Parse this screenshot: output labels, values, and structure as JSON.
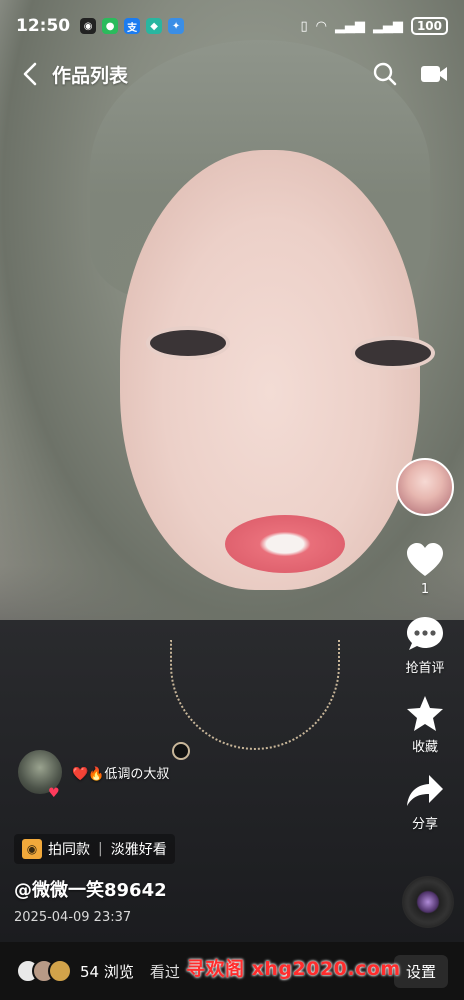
{
  "status": {
    "time": "12:50",
    "battery": "100",
    "notif_icons": [
      "qq-icon",
      "wechat-icon",
      "alipay-icon",
      "shield-icon",
      "app-icon"
    ]
  },
  "topnav": {
    "title": "作品列表"
  },
  "actions": {
    "like_count": "1",
    "comment_label": "抢首评",
    "favorite_label": "收藏",
    "share_label": "分享"
  },
  "overlay": {
    "comment_text": "❤️🔥低调の大叔",
    "tag_label": "拍同款",
    "tag_text": "淡雅好看",
    "author": "@微微一笑89642",
    "date": "2025-04-09 23:37"
  },
  "bottombar": {
    "views": "54 浏览",
    "see_label": "看过",
    "settings_label": "设置"
  },
  "watermark": "寻欢阁 xhg2020.com",
  "colors": {
    "accent": "#ff2d2d",
    "like": "#ffffff",
    "bottom_bg": "#121212"
  }
}
